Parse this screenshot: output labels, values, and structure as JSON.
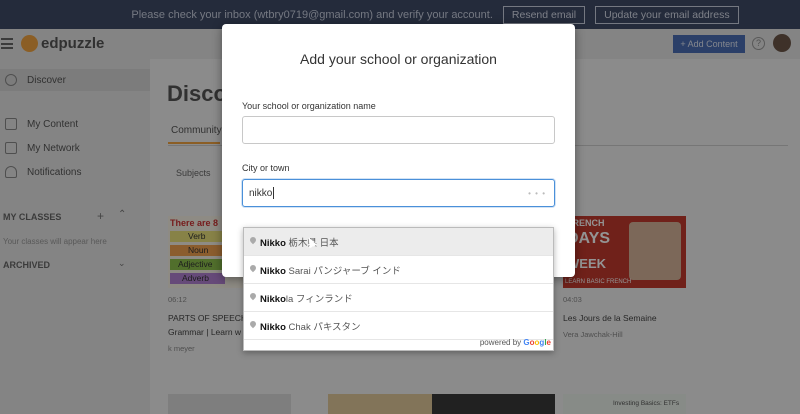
{
  "banner": {
    "message": "Please check your inbox (wtbry0719@gmail.com) and verify your account.",
    "resend_label": "Resend email",
    "update_label": "Update your email address"
  },
  "header": {
    "brand": "edpuzzle",
    "add_content_label": "+ Add Content",
    "help_label": "?"
  },
  "sidebar": {
    "items": [
      {
        "label": "Discover",
        "icon": "compass-icon"
      },
      {
        "label": "My Content",
        "icon": "folder-icon"
      },
      {
        "label": "My Network",
        "icon": "network-icon"
      },
      {
        "label": "Notifications",
        "icon": "bell-icon"
      }
    ],
    "my_classes_heading": "MY CLASSES",
    "classes_empty": "Your classes will appear here",
    "archived_heading": "ARCHIVED"
  },
  "main": {
    "title": "Discov",
    "tab": "Community",
    "filter_label": "Subjects",
    "cards": [
      {
        "duration": "06:12",
        "title_line1": "PARTS OF SPEECH",
        "title_line2": "Grammar | Learn w",
        "author": "k meyer",
        "thumb_words": [
          "There are 8",
          "Verb",
          "Noun",
          "Adjective",
          "Adverb"
        ]
      },
      {
        "duration": "04:03",
        "title_line1": "Les Jours de la Semaine",
        "author": "Vera Jawchak-Hill",
        "thumb_words": [
          "FRENCH",
          "DAYS",
          "WEEK",
          "LEARN BASIC FRENCH"
        ]
      }
    ],
    "bottom_card_text": "Investing Basics: ETFs"
  },
  "modal": {
    "title": "Add your school or organization",
    "name_label": "Your school or organization name",
    "name_value": "",
    "city_label": "City or town",
    "city_value": "nikko"
  },
  "suggestions": [
    {
      "bold": "Nikko",
      "rest": " 栃木県 日本"
    },
    {
      "bold": "Nikko",
      "rest": " Sarai パンジャーブ インド"
    },
    {
      "bold": "Nikko",
      "rest": "la フィンランド"
    },
    {
      "bold": "Nikko",
      "rest": " Chak パキスタン"
    }
  ],
  "powered_by": "powered by",
  "google_letters": [
    "G",
    "o",
    "o",
    "g",
    "l",
    "e"
  ],
  "colors": {
    "accent": "#f0a340",
    "brand_blue": "#4b6db3",
    "focus": "#4a90d9"
  }
}
